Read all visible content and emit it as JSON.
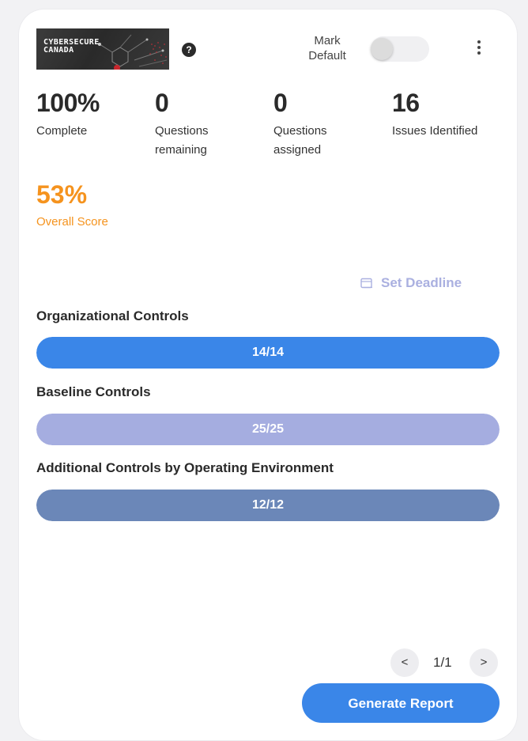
{
  "header": {
    "logo_text": "CYBERSECURE\nCANADA",
    "help_icon": "question-circle-icon",
    "mark_default_label": "Mark\nDefault",
    "mark_default_on": false,
    "menu_icon": "kebab-menu-icon"
  },
  "stats": [
    {
      "value": "100%",
      "label": "Complete"
    },
    {
      "value": "0",
      "label": "Questions remaining"
    },
    {
      "value": "0",
      "label": "Questions assigned"
    },
    {
      "value": "16",
      "label": "Issues Identified"
    }
  ],
  "score": {
    "value": "53%",
    "label": "Overall Score",
    "color": "#f5931e"
  },
  "deadline": {
    "label": "Set Deadline",
    "icon": "calendar-icon",
    "color": "#aab0e0"
  },
  "categories": [
    {
      "title": "Organizational Controls",
      "progress": "14/14",
      "fraction": 1.0,
      "color": "#3a86e8"
    },
    {
      "title": "Baseline Controls",
      "progress": "25/25",
      "fraction": 1.0,
      "color": "#a5ade0"
    },
    {
      "title": "Additional Controls by Operating Environment",
      "progress": "12/12",
      "fraction": 1.0,
      "color": "#6b87b8"
    }
  ],
  "pagination": {
    "prev": "<",
    "page_text": "1/1",
    "next": ">"
  },
  "actions": {
    "generate_report": "Generate Report"
  }
}
